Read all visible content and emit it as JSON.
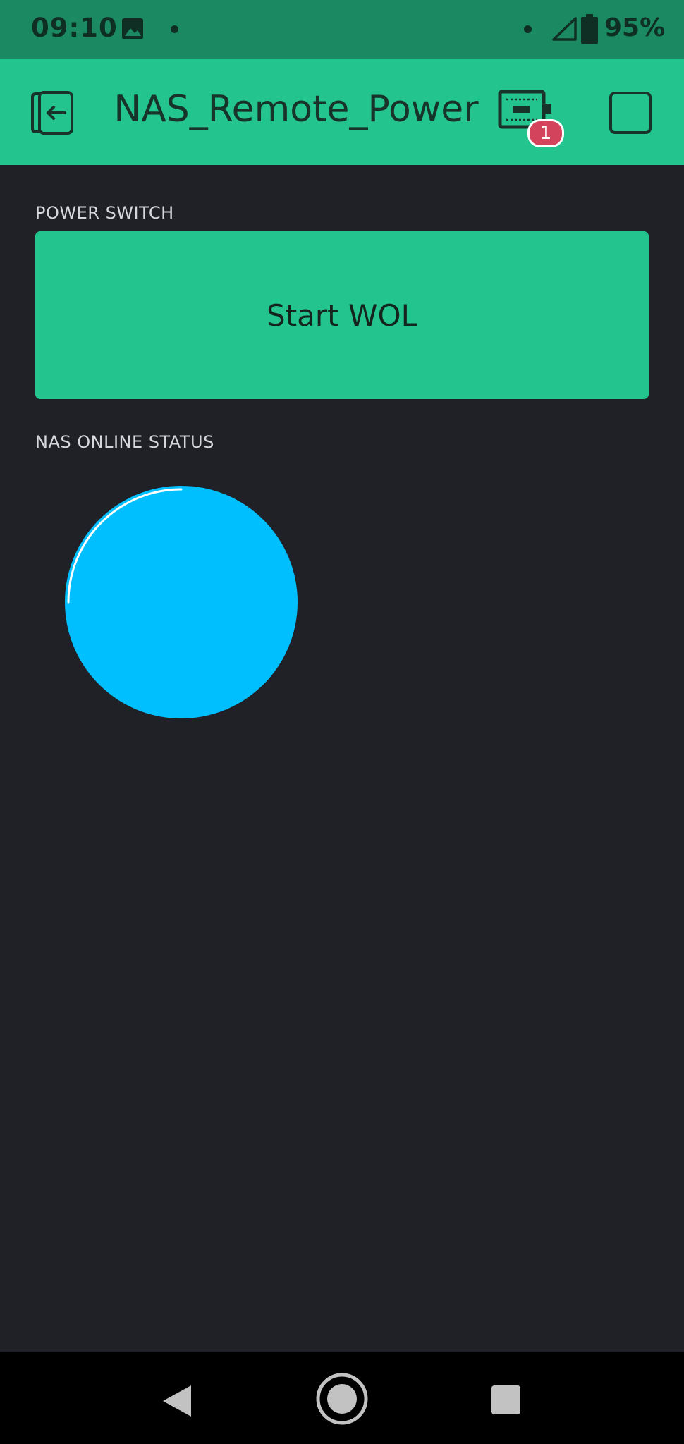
{
  "status_bar": {
    "time": "09:10",
    "battery_percent": "95%",
    "battery_level": 0.95,
    "icons": [
      "image-icon",
      "notification-dot-icon",
      "notification-dot-icon",
      "signal-icon",
      "battery-icon"
    ]
  },
  "app_bar": {
    "title": "NAS_Remote_Power",
    "notification_count": "1",
    "icons": [
      "exit-icon",
      "device-icon",
      "square-icon"
    ]
  },
  "widgets": {
    "power_switch": {
      "label": "POWER SWITCH",
      "button_text": "Start WOL"
    },
    "online_status": {
      "label": "NAS ONLINE STATUS",
      "led_color": "#00bfff"
    }
  },
  "nav_bar": {
    "icons": [
      "back-icon",
      "home-icon",
      "recents-icon"
    ]
  },
  "colors": {
    "accent": "#23c48e",
    "status_bar": "#1b8a63",
    "background": "#202127",
    "badge": "#d3435c",
    "led": "#00bfff"
  }
}
